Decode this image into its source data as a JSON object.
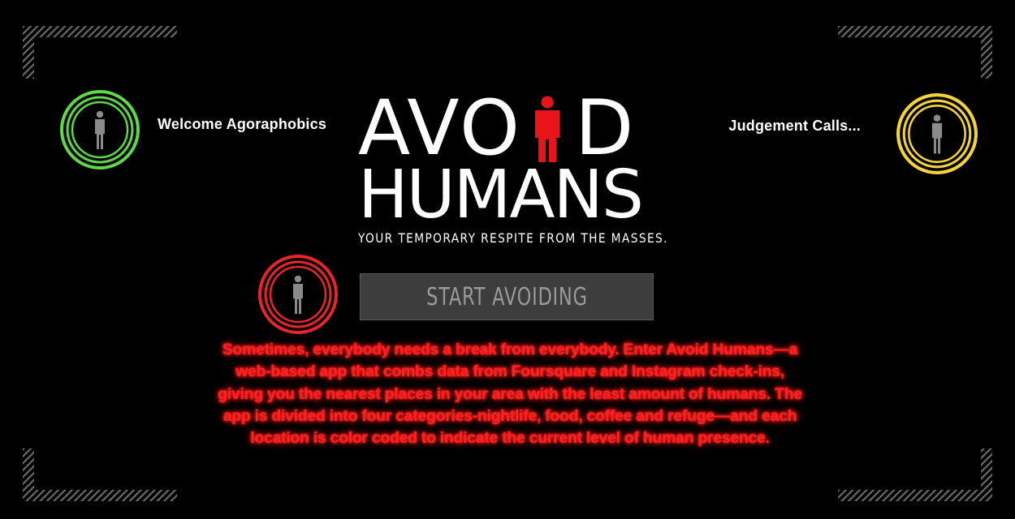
{
  "app": {
    "title_line1_a": "AVO",
    "title_line1_b": "D",
    "title_line2": "HUMANS",
    "tagline": "YOUR TEMPORARY RESPITE FROM THE MASSES."
  },
  "nav": {
    "welcome_label": "Welcome Agoraphobics",
    "judgement_label": "Judgement Calls..."
  },
  "cta": {
    "label": "START AVOIDING"
  },
  "description": "Sometimes, everybody needs a break from everybody. Enter Avoid Humans—a web-based app that combs data from Foursquare and Instagram check-ins, giving you the nearest places in your area with the least amount of humans. The app is divided into four categories-nightlife, food, coffee and refuge—and each location is color coded to indicate the current level of human presence.",
  "colors": {
    "background": "#000000",
    "ring_green": "#5fd84a",
    "ring_yellow": "#f5d33a",
    "ring_red": "#e8262a",
    "logo_figure": "#e8141a",
    "description_text": "#ff2020",
    "button_bg": "#3d3d3d",
    "button_text": "#9a9a9a"
  },
  "icons": {
    "ring_figure": "person-icon",
    "logo_figure": "person-icon"
  }
}
